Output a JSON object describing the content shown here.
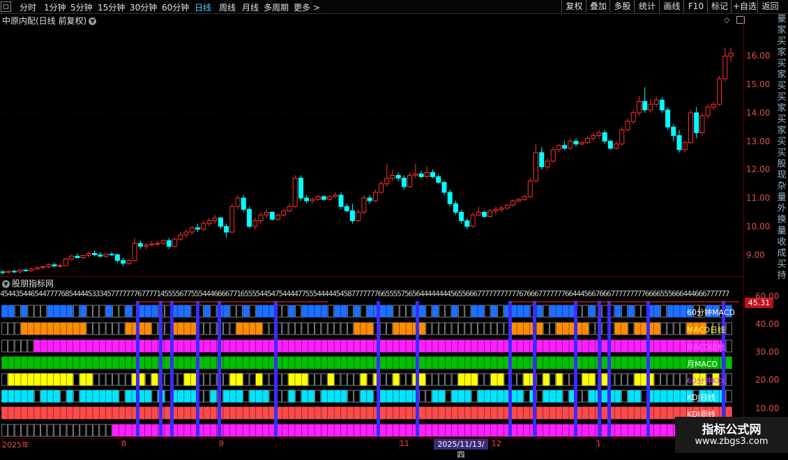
{
  "periods": [
    "分时",
    "1分钟",
    "5分钟",
    "15分钟",
    "30分钟",
    "60分钟",
    "日线",
    "周线",
    "月线",
    "多周期",
    "更多 >"
  ],
  "active_period": "日线",
  "right_buttons": [
    "复权",
    "叠加",
    "多股",
    "统计",
    "画线",
    "F10",
    "标记",
    "+自选",
    "返回"
  ],
  "stock_title": "中原内配(日线 前复权)",
  "indicator_title": "股朋指标网",
  "price_axis": [
    "16.00",
    "15.00",
    "14.00",
    "13.00",
    "12.00",
    "11.00",
    "10.00",
    "9.00"
  ],
  "ind_axis": [
    "60.00",
    "40.00",
    "30.00",
    "20.00",
    "10.00"
  ],
  "current_value": "45.31",
  "row_labels": [
    {
      "text": "60分钟MACD",
      "color": "#ffffff"
    },
    {
      "text": "MACD日线",
      "color": "#ffff40"
    },
    {
      "text": "MACD周线",
      "color": "#ff60ff"
    },
    {
      "text": "月MACD",
      "color": "#ffffff"
    },
    {
      "text": "60分钟KDJ",
      "color": "#c040ff"
    },
    {
      "text": "KDJ日线",
      "color": "#ffffff"
    },
    {
      "text": "KDJ周线",
      "color": "#ffffff"
    }
  ],
  "number_strip": "45443544654477776854444533345777777767777145555677555444666677165555445475444477555444445458777777766555575656444444445655666777777777776766677777776644456676667777777776666555666444666777777",
  "dates": [
    {
      "text": "2025年",
      "x": 3
    },
    {
      "text": "8",
      "x": 174
    },
    {
      "text": "9",
      "x": 314
    },
    {
      "text": "11",
      "x": 573
    },
    {
      "text": "12",
      "x": 705
    },
    {
      "text": "1",
      "x": 855
    }
  ],
  "cursor_date": "2025/11/13/四",
  "watermark": {
    "title": "指标公式网",
    "url": "www.zbgs3.com"
  },
  "right_strip_chars": [
    "豪",
    "家",
    "买",
    "家",
    "买",
    "家",
    "买",
    "买",
    "家",
    "买",
    "家",
    "买",
    "买",
    "股",
    "现",
    "杂",
    "量",
    "外",
    "换",
    "量",
    "收",
    "成",
    "买",
    "持"
  ],
  "colors": {
    "up": "#ff3030",
    "down": "#00ffff",
    "grid": "#3a0000"
  },
  "chart_data": {
    "type": "candlestick",
    "ylim": [
      8.4,
      16.5
    ],
    "ohlc": [
      [
        8.4,
        8.46,
        8.3,
        8.38
      ],
      [
        8.38,
        8.45,
        8.33,
        8.42
      ],
      [
        8.42,
        8.48,
        8.36,
        8.4
      ],
      [
        8.4,
        8.5,
        8.35,
        8.46
      ],
      [
        8.46,
        8.52,
        8.4,
        8.44
      ],
      [
        8.44,
        8.55,
        8.4,
        8.5
      ],
      [
        8.5,
        8.6,
        8.45,
        8.55
      ],
      [
        8.55,
        8.62,
        8.5,
        8.58
      ],
      [
        8.58,
        8.7,
        8.52,
        8.65
      ],
      [
        8.65,
        8.72,
        8.58,
        8.6
      ],
      [
        8.6,
        8.7,
        8.55,
        8.62
      ],
      [
        8.62,
        8.9,
        8.6,
        8.85
      ],
      [
        8.85,
        9.0,
        8.8,
        8.95
      ],
      [
        8.95,
        9.05,
        8.85,
        8.9
      ],
      [
        8.9,
        9.0,
        8.85,
        8.98
      ],
      [
        8.98,
        9.1,
        8.9,
        9.05
      ],
      [
        9.05,
        9.15,
        8.95,
        9.0
      ],
      [
        9.0,
        9.1,
        8.9,
        8.95
      ],
      [
        8.95,
        9.05,
        8.88,
        9.02
      ],
      [
        9.02,
        9.1,
        8.95,
        9.0
      ],
      [
        9.0,
        9.05,
        8.7,
        8.8
      ],
      [
        8.8,
        8.9,
        8.6,
        8.7
      ],
      [
        8.7,
        8.85,
        8.65,
        8.8
      ],
      [
        8.8,
        9.6,
        8.75,
        9.4
      ],
      [
        9.4,
        9.5,
        9.2,
        9.3
      ],
      [
        9.3,
        9.4,
        9.2,
        9.35
      ],
      [
        9.35,
        9.5,
        9.3,
        9.38
      ],
      [
        9.38,
        9.5,
        9.3,
        9.4
      ],
      [
        9.4,
        9.55,
        9.35,
        9.5
      ],
      [
        9.5,
        9.6,
        9.2,
        9.3
      ],
      [
        9.3,
        9.6,
        9.25,
        9.55
      ],
      [
        9.55,
        9.8,
        9.5,
        9.7
      ],
      [
        9.7,
        9.9,
        9.6,
        9.8
      ],
      [
        9.8,
        10.0,
        9.7,
        9.95
      ],
      [
        9.95,
        10.1,
        9.8,
        9.9
      ],
      [
        9.9,
        10.2,
        9.85,
        10.1
      ],
      [
        10.1,
        10.3,
        10.0,
        10.2
      ],
      [
        10.2,
        10.4,
        10.1,
        10.3
      ],
      [
        10.3,
        10.3,
        9.9,
        10.0
      ],
      [
        10.0,
        10.1,
        9.6,
        9.8
      ],
      [
        9.8,
        10.8,
        9.75,
        10.7
      ],
      [
        10.7,
        11.1,
        10.6,
        11.0
      ],
      [
        11.0,
        11.1,
        10.5,
        10.6
      ],
      [
        10.6,
        10.7,
        9.95,
        10.0
      ],
      [
        10.0,
        10.3,
        9.9,
        10.2
      ],
      [
        10.2,
        10.5,
        10.1,
        10.4
      ],
      [
        10.4,
        10.6,
        10.3,
        10.5
      ],
      [
        10.5,
        10.5,
        10.2,
        10.25
      ],
      [
        10.25,
        10.45,
        10.2,
        10.4
      ],
      [
        10.4,
        10.6,
        10.35,
        10.55
      ],
      [
        10.55,
        10.8,
        10.5,
        10.7
      ],
      [
        10.7,
        11.8,
        10.65,
        11.7
      ],
      [
        11.7,
        11.8,
        10.9,
        11.0
      ],
      [
        11.0,
        11.1,
        10.8,
        10.9
      ],
      [
        10.9,
        11.0,
        10.8,
        10.95
      ],
      [
        10.95,
        11.1,
        10.9,
        11.05
      ],
      [
        11.05,
        11.1,
        10.9,
        10.95
      ],
      [
        10.95,
        11.1,
        10.9,
        11.05
      ],
      [
        11.05,
        11.2,
        11.0,
        11.1
      ],
      [
        11.1,
        11.2,
        10.6,
        10.7
      ],
      [
        10.7,
        10.8,
        10.5,
        10.55
      ],
      [
        10.55,
        10.8,
        10.1,
        10.2
      ],
      [
        10.2,
        10.6,
        10.15,
        10.5
      ],
      [
        10.5,
        11.1,
        10.45,
        11.0
      ],
      [
        11.0,
        11.1,
        10.8,
        10.9
      ],
      [
        10.9,
        11.3,
        10.85,
        11.2
      ],
      [
        11.2,
        11.6,
        11.15,
        11.5
      ],
      [
        11.5,
        12.2,
        11.4,
        11.7
      ],
      [
        11.7,
        12.0,
        11.6,
        11.8
      ],
      [
        11.8,
        11.9,
        11.6,
        11.7
      ],
      [
        11.7,
        11.8,
        11.3,
        11.4
      ],
      [
        11.4,
        11.9,
        11.35,
        11.8
      ],
      [
        11.8,
        12.2,
        11.7,
        11.85
      ],
      [
        11.85,
        11.95,
        11.7,
        11.75
      ],
      [
        11.75,
        12.1,
        11.7,
        11.9
      ],
      [
        11.9,
        12.0,
        11.7,
        11.75
      ],
      [
        11.75,
        11.85,
        11.5,
        11.55
      ],
      [
        11.55,
        11.6,
        11.1,
        11.2
      ],
      [
        11.2,
        11.3,
        10.7,
        10.8
      ],
      [
        10.8,
        10.9,
        10.4,
        10.5
      ],
      [
        10.5,
        10.6,
        10.1,
        10.2
      ],
      [
        10.2,
        10.3,
        9.9,
        10.0
      ],
      [
        10.0,
        10.5,
        9.95,
        10.4
      ],
      [
        10.4,
        10.7,
        10.35,
        10.5
      ],
      [
        10.5,
        10.55,
        10.3,
        10.35
      ],
      [
        10.35,
        10.6,
        10.3,
        10.55
      ],
      [
        10.55,
        10.7,
        10.4,
        10.6
      ],
      [
        10.6,
        10.75,
        10.5,
        10.65
      ],
      [
        10.65,
        10.8,
        10.6,
        10.75
      ],
      [
        10.75,
        10.95,
        10.7,
        10.9
      ],
      [
        10.9,
        11.0,
        10.85,
        10.95
      ],
      [
        10.95,
        11.1,
        10.9,
        11.05
      ],
      [
        11.05,
        11.7,
        11.0,
        11.6
      ],
      [
        11.6,
        12.9,
        11.55,
        12.6
      ],
      [
        12.6,
        12.8,
        12.0,
        12.1
      ],
      [
        12.1,
        12.4,
        12.0,
        12.3
      ],
      [
        12.3,
        12.8,
        12.25,
        12.7
      ],
      [
        12.7,
        12.9,
        12.6,
        12.85
      ],
      [
        12.85,
        13.0,
        12.7,
        12.75
      ],
      [
        12.75,
        13.1,
        12.7,
        13.0
      ],
      [
        13.0,
        13.1,
        12.8,
        12.9
      ],
      [
        12.9,
        13.0,
        12.85,
        12.95
      ],
      [
        12.95,
        13.2,
        12.9,
        13.1
      ],
      [
        13.1,
        13.3,
        13.0,
        13.2
      ],
      [
        13.2,
        13.4,
        13.1,
        13.3
      ],
      [
        13.3,
        13.4,
        12.9,
        13.0
      ],
      [
        13.0,
        13.05,
        12.7,
        12.75
      ],
      [
        12.75,
        13.0,
        12.7,
        12.9
      ],
      [
        12.9,
        13.5,
        12.85,
        13.4
      ],
      [
        13.4,
        13.8,
        13.35,
        13.7
      ],
      [
        13.7,
        14.1,
        13.6,
        14.0
      ],
      [
        14.0,
        14.6,
        13.9,
        14.4
      ],
      [
        14.4,
        14.9,
        14.0,
        14.1
      ],
      [
        14.1,
        14.5,
        14.0,
        14.3
      ],
      [
        14.3,
        14.6,
        14.2,
        14.45
      ],
      [
        14.45,
        14.55,
        14.0,
        14.1
      ],
      [
        14.1,
        14.2,
        13.4,
        13.5
      ],
      [
        13.5,
        13.6,
        13.0,
        13.2
      ],
      [
        13.2,
        13.4,
        12.6,
        12.7
      ],
      [
        12.7,
        13.0,
        12.6,
        12.95
      ],
      [
        12.95,
        14.1,
        12.9,
        14.0
      ],
      [
        14.0,
        14.2,
        13.1,
        13.3
      ],
      [
        13.3,
        14.0,
        13.2,
        13.9
      ],
      [
        13.9,
        14.3,
        13.8,
        14.2
      ],
      [
        14.2,
        14.4,
        14.1,
        14.3
      ],
      [
        14.3,
        15.3,
        14.25,
        15.2
      ],
      [
        15.2,
        16.3,
        15.1,
        16.0
      ],
      [
        16.0,
        16.3,
        15.8,
        16.1
      ]
    ]
  }
}
